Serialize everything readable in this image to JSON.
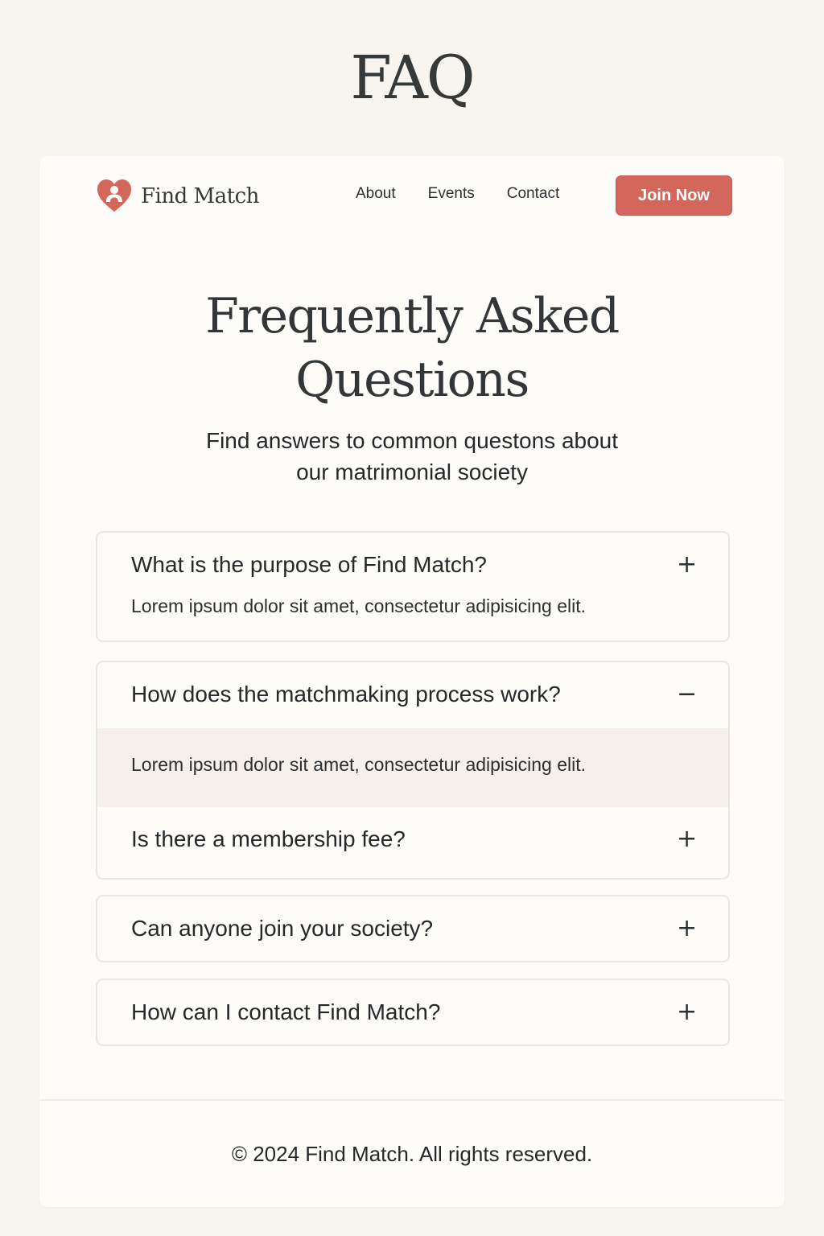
{
  "page": {
    "heading": "FAQ"
  },
  "brand": {
    "name": "Find Match",
    "icon": "heart-people-icon",
    "accent_color": "#d4675c"
  },
  "nav": {
    "links": [
      "About",
      "Events",
      "Contact"
    ],
    "cta_label": "Join Now"
  },
  "hero": {
    "title_line1": "Frequently Asked",
    "title_line2": "Questions",
    "subtitle_line1": "Find answers to common questons about",
    "subtitle_line2": "our matrimonial society"
  },
  "faqs": [
    {
      "question": "What is the purpose of Find Match?",
      "answer": "Lorem ipsum dolor sit amet, consectetur adipisicing elit.",
      "toggle": "+"
    },
    {
      "question": "How does the matchmaking process work?",
      "answer": "Lorem ipsum dolor sit amet, consectetur adipisicing elit.",
      "toggle": "−",
      "expanded": true
    },
    {
      "question": "Is there a membership fee?",
      "toggle": "+"
    },
    {
      "question": "Can anyone join your society?",
      "toggle": "+"
    },
    {
      "question": "How can I contact Find Match?",
      "toggle": "+"
    }
  ],
  "footer": {
    "copyright": "© 2024 Find Match. All rights reserved."
  }
}
